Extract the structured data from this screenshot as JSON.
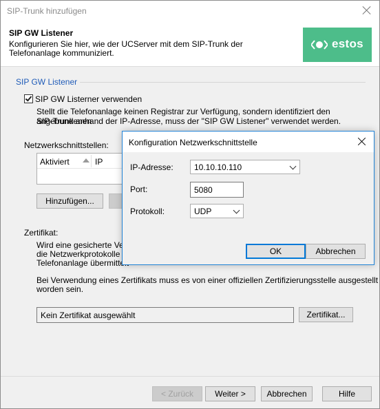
{
  "window": {
    "title": "SIP-Trunk hinzufügen"
  },
  "header": {
    "title": "SIP GW Listener",
    "description": "Konfigurieren Sie hier, wie der UCServer mit dem SIP-Trunk der Telefonanlage kommuniziert.",
    "logo_text": "estos",
    "logo_color": "#4dbd8a"
  },
  "listener": {
    "section_title": "SIP GW Listener",
    "checkbox_label": "SIP GW Listerner verwenden",
    "checkbox_checked": true,
    "description_line1": "Stellt die Telefonanlage keinen Registrar zur Verfügung, sondern identifiziert den angebundenen",
    "description_line2": "SIP-Trunk anhand der IP-Adresse, muss der \"SIP GW Listener\" verwendet werden.",
    "interfaces_label": "Netzwerkschnittstellen:",
    "columns": [
      "Aktiviert",
      "IP"
    ],
    "add_button": "Hinzufügen..."
  },
  "certificate": {
    "label": "Zertifikat:",
    "text_line1": "Wird eine gesicherte Verbi",
    "text_line2": "die Netzwerkprotokolle TLS",
    "text_line3": "Telefonanlage übermittelt",
    "notice_line1": "Bei Verwendung eines Zertifikats muss es von einer offiziellen Zertifizierungsstelle ausgestellt",
    "notice_line2": "worden sein.",
    "field_value": "Kein Zertifikat ausgewählt",
    "button": "Zertifikat..."
  },
  "footer": {
    "back": "< Zurück",
    "next": "Weiter >",
    "cancel": "Abbrechen",
    "help": "Hilfe"
  },
  "dialog": {
    "title": "Konfiguration Netzwerkschnittstelle",
    "ip_label": "IP-Adresse:",
    "ip_value": "10.10.10.110",
    "port_label": "Port:",
    "port_value": "5080",
    "protocol_label": "Protokoll:",
    "protocol_value": "UDP",
    "ok": "OK",
    "cancel": "Abbrechen"
  },
  "colors": {
    "accent": "#0078d7",
    "section_title": "#1f5bb8"
  }
}
